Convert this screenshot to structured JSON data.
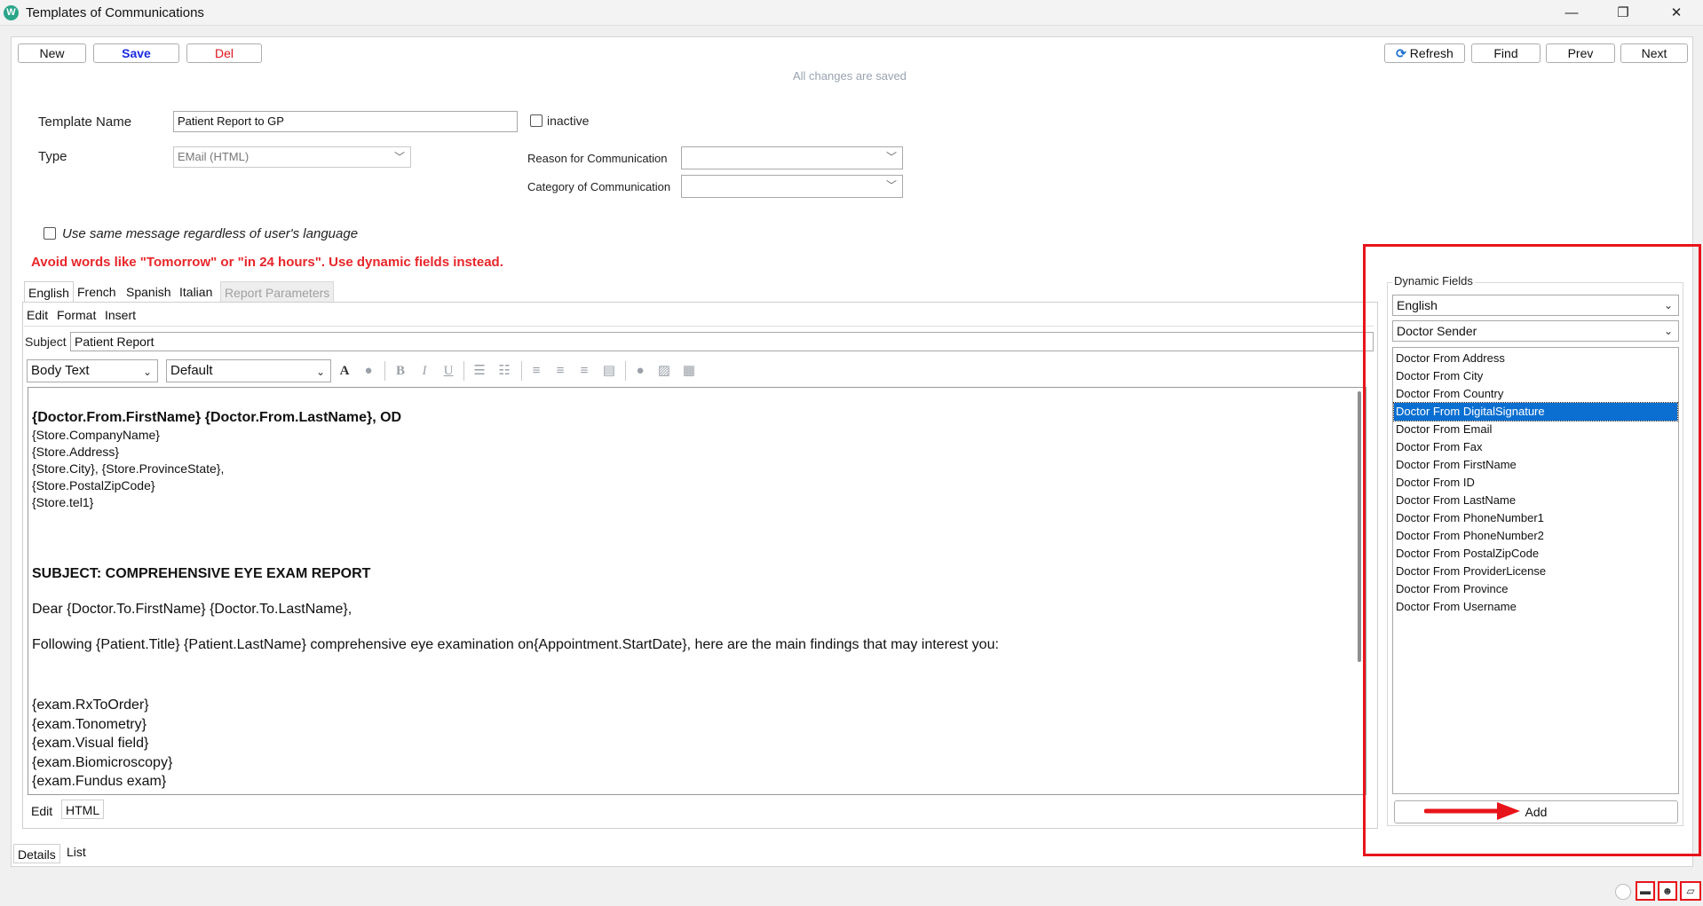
{
  "window": {
    "title": "Templates of Communications",
    "app_icon": "W",
    "controls": {
      "minimize": "—",
      "restore": "❐",
      "close": "✕"
    }
  },
  "toolbar": {
    "new_label": "New",
    "save_label": "Save",
    "del_label": "Del",
    "refresh_label": "Refresh",
    "find_label": "Find",
    "prev_label": "Prev",
    "next_label": "Next",
    "status": "All changes are saved"
  },
  "form": {
    "template_name_label": "Template Name",
    "template_name_value": "Patient Report to GP",
    "inactive_label": "inactive",
    "type_label": "Type",
    "type_value": "EMail (HTML)",
    "reason_label": "Reason for Communication",
    "reason_value": "",
    "category_label": "Category of Communication",
    "category_value": "",
    "same_message_label": "Use same message regardless of user's language",
    "warning": "Avoid words like \"Tomorrow\" or \"in 24 hours\".  Use dynamic fields instead."
  },
  "language_tabs": [
    {
      "label": "English",
      "active": true
    },
    {
      "label": "French",
      "active": false
    },
    {
      "label": "Spanish",
      "active": false
    },
    {
      "label": "Italian",
      "active": false
    },
    {
      "label": "Report Parameters",
      "active": false,
      "disabled": true
    }
  ],
  "editor": {
    "menu": [
      "Edit",
      "Format",
      "Insert"
    ],
    "subject_label": "Subject",
    "subject_value": "Patient Report",
    "style_select": "Body Text",
    "font_select": "Default",
    "body": {
      "sender_line": "{Doctor.From.FirstName} {Doctor.From.LastName}, OD",
      "store_lines": [
        "{Store.CompanyName}",
        "{Store.Address}",
        "{Store.City}, {Store.ProvinceState},",
        "{Store.PostalZipCode}",
        "{Store.tel1}"
      ],
      "subject_heading": "SUBJECT: COMPREHENSIVE EYE EXAM REPORT",
      "greeting": "Dear {Doctor.To.FirstName} {Doctor.To.LastName},",
      "paragraph": "Following {Patient.Title} {Patient.LastName} comprehensive eye examination on{Appointment.StartDate}, here are the main findings that may interest you:",
      "exam_lines": [
        "{exam.RxToOrder}",
        "{exam.Tonometry}",
        "{exam.Visual field}",
        "{exam.Biomicroscopy}",
        "{exam.Fundus exam}"
      ]
    },
    "mode_tabs": [
      {
        "label": "Edit",
        "active": false
      },
      {
        "label": "HTML",
        "active": true
      }
    ]
  },
  "dynamic_fields": {
    "title": "Dynamic Fields",
    "language_value": "English",
    "group_value": "Doctor Sender",
    "items": [
      "Doctor From Address",
      "Doctor From City",
      "Doctor From Country",
      "Doctor From DigitalSignature",
      "Doctor From Email",
      "Doctor From Fax",
      "Doctor From FirstName",
      "Doctor From ID",
      "Doctor From LastName",
      "Doctor From PhoneNumber1",
      "Doctor From PhoneNumber2",
      "Doctor From PostalZipCode",
      "Doctor From ProviderLicense",
      "Doctor From Province",
      "Doctor From Username"
    ],
    "selected_index": 3,
    "add_label": "Add"
  },
  "bottom_tabs": [
    {
      "label": "Details",
      "active": true
    },
    {
      "label": "List",
      "active": false
    }
  ],
  "colors": {
    "accent_blue": "#1a2be0",
    "danger_red": "#e0141b",
    "warning_red": "#e8262a",
    "selection": "#0b6fd1",
    "annotation_red": "#e8141b"
  }
}
